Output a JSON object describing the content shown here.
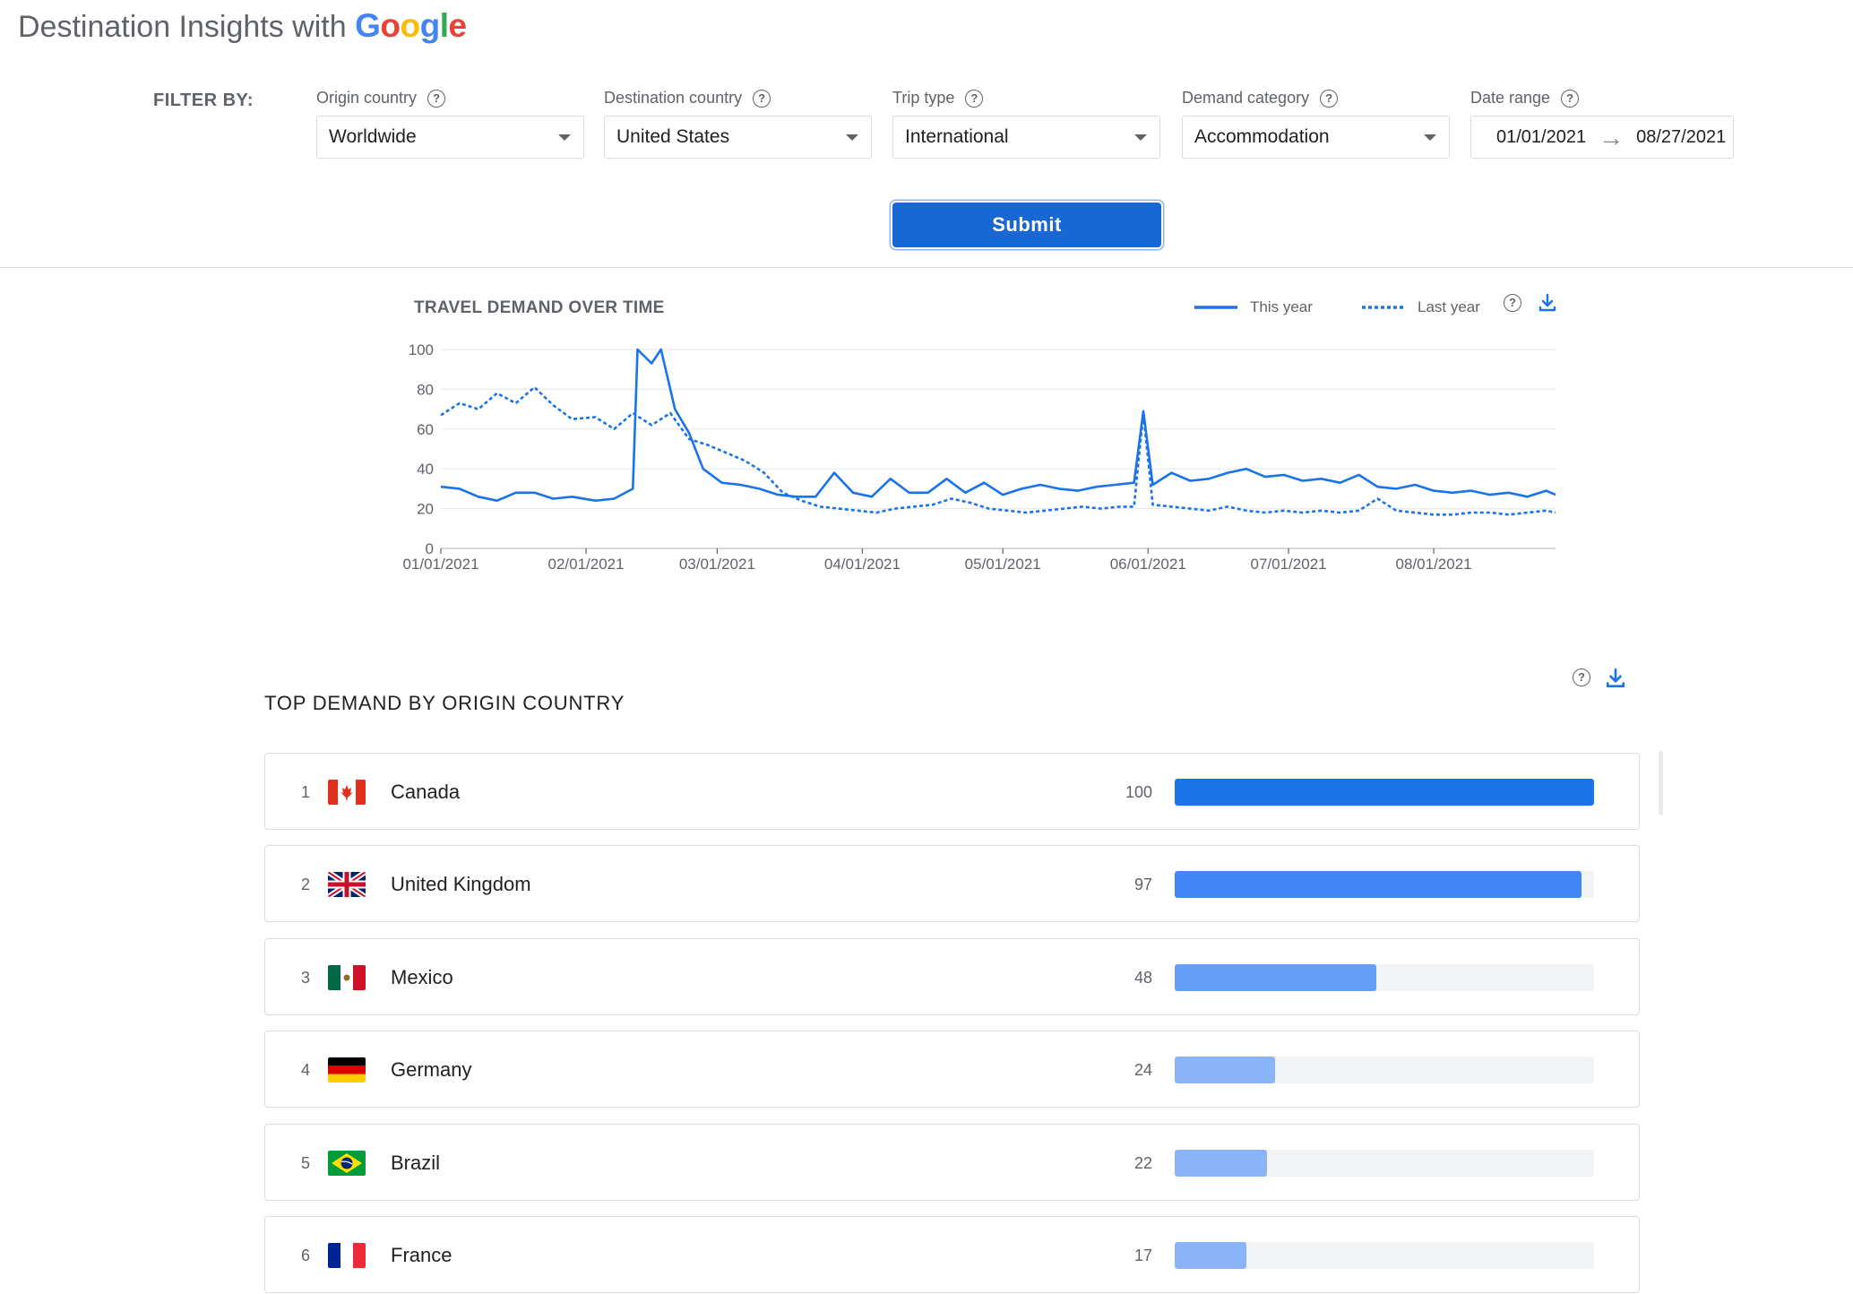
{
  "header": {
    "title_prefix": "Destination Insights with",
    "logo_letters": [
      "G",
      "o",
      "o",
      "g",
      "l",
      "e"
    ]
  },
  "filters": {
    "label": "FILTER BY:",
    "origin": {
      "label": "Origin country",
      "value": "Worldwide"
    },
    "destination": {
      "label": "Destination country",
      "value": "United States"
    },
    "trip_type": {
      "label": "Trip type",
      "value": "International"
    },
    "demand_category": {
      "label": "Demand category",
      "value": "Accommodation"
    },
    "date_range": {
      "label": "Date range",
      "start": "01/01/2021",
      "end": "08/27/2021"
    },
    "submit_label": "Submit"
  },
  "chart": {
    "title": "TRAVEL DEMAND OVER TIME",
    "legend_this_year": "This year",
    "legend_last_year": "Last year"
  },
  "chart_data": {
    "type": "line",
    "title": "TRAVEL DEMAND OVER TIME",
    "xlabel": "",
    "ylabel": "",
    "ylim": [
      0,
      100
    ],
    "yticks": [
      0,
      20,
      40,
      60,
      80,
      100
    ],
    "xticks": [
      "01/01/2021",
      "02/01/2021",
      "03/01/2021",
      "04/01/2021",
      "05/01/2021",
      "06/01/2021",
      "07/01/2021",
      "08/01/2021"
    ],
    "grid": true,
    "legend_position": "top-right",
    "colors": {
      "this_year": "#1a73e8",
      "last_year": "#1a73e8"
    },
    "series": [
      {
        "name": "This year",
        "style": "solid",
        "points": [
          [
            "01/01/2021",
            31
          ],
          [
            "01/05/2021",
            30
          ],
          [
            "01/09/2021",
            26
          ],
          [
            "01/13/2021",
            24
          ],
          [
            "01/17/2021",
            28
          ],
          [
            "01/21/2021",
            28
          ],
          [
            "01/25/2021",
            25
          ],
          [
            "01/29/2021",
            26
          ],
          [
            "02/03/2021",
            24
          ],
          [
            "02/07/2021",
            25
          ],
          [
            "02/11/2021",
            30
          ],
          [
            "02/12/2021",
            100
          ],
          [
            "02/15/2021",
            93
          ],
          [
            "02/17/2021",
            100
          ],
          [
            "02/20/2021",
            70
          ],
          [
            "02/23/2021",
            58
          ],
          [
            "02/26/2021",
            40
          ],
          [
            "03/02/2021",
            33
          ],
          [
            "03/06/2021",
            32
          ],
          [
            "03/10/2021",
            30
          ],
          [
            "03/14/2021",
            27
          ],
          [
            "03/18/2021",
            26
          ],
          [
            "03/22/2021",
            26
          ],
          [
            "03/26/2021",
            38
          ],
          [
            "03/30/2021",
            28
          ],
          [
            "04/03/2021",
            26
          ],
          [
            "04/07/2021",
            35
          ],
          [
            "04/11/2021",
            28
          ],
          [
            "04/15/2021",
            28
          ],
          [
            "04/19/2021",
            35
          ],
          [
            "04/23/2021",
            28
          ],
          [
            "04/27/2021",
            33
          ],
          [
            "05/01/2021",
            27
          ],
          [
            "05/05/2021",
            30
          ],
          [
            "05/09/2021",
            32
          ],
          [
            "05/13/2021",
            30
          ],
          [
            "05/17/2021",
            29
          ],
          [
            "05/21/2021",
            31
          ],
          [
            "05/25/2021",
            32
          ],
          [
            "05/29/2021",
            33
          ],
          [
            "05/31/2021",
            69
          ],
          [
            "06/02/2021",
            32
          ],
          [
            "06/06/2021",
            38
          ],
          [
            "06/10/2021",
            34
          ],
          [
            "06/14/2021",
            35
          ],
          [
            "06/18/2021",
            38
          ],
          [
            "06/22/2021",
            40
          ],
          [
            "06/26/2021",
            36
          ],
          [
            "06/30/2021",
            37
          ],
          [
            "07/04/2021",
            34
          ],
          [
            "07/08/2021",
            35
          ],
          [
            "07/12/2021",
            33
          ],
          [
            "07/16/2021",
            37
          ],
          [
            "07/20/2021",
            31
          ],
          [
            "07/24/2021",
            30
          ],
          [
            "07/28/2021",
            32
          ],
          [
            "08/01/2021",
            29
          ],
          [
            "08/05/2021",
            28
          ],
          [
            "08/09/2021",
            29
          ],
          [
            "08/13/2021",
            27
          ],
          [
            "08/17/2021",
            28
          ],
          [
            "08/21/2021",
            26
          ],
          [
            "08/25/2021",
            29
          ],
          [
            "08/27/2021",
            27
          ]
        ]
      },
      {
        "name": "Last year",
        "style": "dashed",
        "points": [
          [
            "01/01/2021",
            67
          ],
          [
            "01/05/2021",
            73
          ],
          [
            "01/09/2021",
            70
          ],
          [
            "01/13/2021",
            78
          ],
          [
            "01/17/2021",
            73
          ],
          [
            "01/21/2021",
            81
          ],
          [
            "01/25/2021",
            72
          ],
          [
            "01/29/2021",
            65
          ],
          [
            "02/03/2021",
            66
          ],
          [
            "02/07/2021",
            60
          ],
          [
            "02/11/2021",
            68
          ],
          [
            "02/15/2021",
            62
          ],
          [
            "02/19/2021",
            68
          ],
          [
            "02/23/2021",
            55
          ],
          [
            "02/27/2021",
            52
          ],
          [
            "03/03/2021",
            48
          ],
          [
            "03/07/2021",
            44
          ],
          [
            "03/11/2021",
            38
          ],
          [
            "03/15/2021",
            28
          ],
          [
            "03/19/2021",
            24
          ],
          [
            "03/23/2021",
            21
          ],
          [
            "03/27/2021",
            20
          ],
          [
            "03/31/2021",
            19
          ],
          [
            "04/04/2021",
            18
          ],
          [
            "04/08/2021",
            20
          ],
          [
            "04/12/2021",
            21
          ],
          [
            "04/16/2021",
            22
          ],
          [
            "04/20/2021",
            25
          ],
          [
            "04/24/2021",
            23
          ],
          [
            "04/28/2021",
            20
          ],
          [
            "05/02/2021",
            19
          ],
          [
            "05/06/2021",
            18
          ],
          [
            "05/10/2021",
            19
          ],
          [
            "05/14/2021",
            20
          ],
          [
            "05/18/2021",
            21
          ],
          [
            "05/22/2021",
            20
          ],
          [
            "05/26/2021",
            21
          ],
          [
            "05/29/2021",
            21
          ],
          [
            "05/31/2021",
            68
          ],
          [
            "06/02/2021",
            22
          ],
          [
            "06/06/2021",
            21
          ],
          [
            "06/10/2021",
            20
          ],
          [
            "06/14/2021",
            19
          ],
          [
            "06/18/2021",
            21
          ],
          [
            "06/22/2021",
            19
          ],
          [
            "06/26/2021",
            18
          ],
          [
            "06/30/2021",
            19
          ],
          [
            "07/04/2021",
            18
          ],
          [
            "07/08/2021",
            19
          ],
          [
            "07/12/2021",
            18
          ],
          [
            "07/16/2021",
            19
          ],
          [
            "07/20/2021",
            25
          ],
          [
            "07/24/2021",
            19
          ],
          [
            "07/28/2021",
            18
          ],
          [
            "08/01/2021",
            17
          ],
          [
            "08/05/2021",
            17
          ],
          [
            "08/09/2021",
            18
          ],
          [
            "08/13/2021",
            18
          ],
          [
            "08/17/2021",
            17
          ],
          [
            "08/21/2021",
            18
          ],
          [
            "08/25/2021",
            19
          ],
          [
            "08/27/2021",
            18
          ]
        ]
      }
    ]
  },
  "table": {
    "title": "TOP DEMAND BY ORIGIN COUNTRY",
    "rows": [
      {
        "rank": "1",
        "country": "Canada",
        "value": "100",
        "fraction": 1.0,
        "color": "#1a73e8",
        "flag": "canada"
      },
      {
        "rank": "2",
        "country": "United Kingdom",
        "value": "97",
        "fraction": 0.97,
        "color": "#4285f4",
        "flag": "uk"
      },
      {
        "rank": "3",
        "country": "Mexico",
        "value": "48",
        "fraction": 0.48,
        "color": "#669df6",
        "flag": "mexico"
      },
      {
        "rank": "4",
        "country": "Germany",
        "value": "24",
        "fraction": 0.24,
        "color": "#8ab4f8",
        "flag": "germany"
      },
      {
        "rank": "5",
        "country": "Brazil",
        "value": "22",
        "fraction": 0.22,
        "color": "#8ab4f8",
        "flag": "brazil"
      },
      {
        "rank": "6",
        "country": "France",
        "value": "17",
        "fraction": 0.17,
        "color": "#8ab4f8",
        "flag": "france"
      }
    ]
  },
  "icons": [
    "help-icon",
    "download-icon",
    "dropdown-caret-icon",
    "arrow-right-icon"
  ]
}
